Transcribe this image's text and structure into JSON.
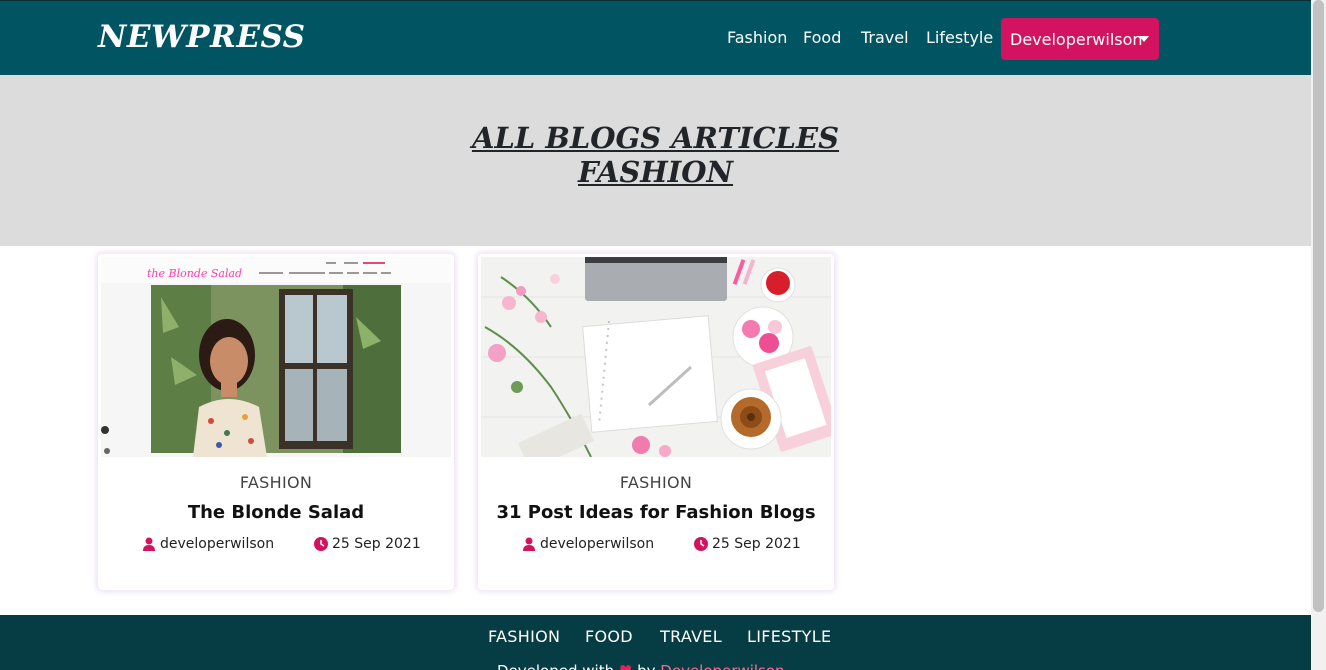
{
  "brand": {
    "name": "NEWPRESS"
  },
  "nav": {
    "links": [
      "Fashion",
      "Food",
      "Travel",
      "Lifestyle"
    ],
    "user_dropdown": "Developerwilson"
  },
  "hero": {
    "title_line1": "ALL BLOGS ARTICLES",
    "title_line2": "FASHION"
  },
  "posts": [
    {
      "category": "FASHION",
      "title": "The Blonde Salad",
      "author": "developerwilson",
      "date": "25 Sep 2021",
      "image_brand": "the Blonde Salad"
    },
    {
      "category": "FASHION",
      "title": "31 Post Ideas for Fashion Blogs",
      "author": "developerwilson",
      "date": "25 Sep 2021"
    }
  ],
  "footer": {
    "links": [
      "FASHION",
      "FOOD",
      "TRAVEL",
      "LIFESTYLE"
    ],
    "credit_prefix": "Developed with",
    "credit_heart": "♥",
    "credit_by": "by",
    "credit_author": "Developerwilson"
  },
  "colors": {
    "navbar": "#015562",
    "accent": "#d3135f",
    "hero_bg": "#dcdcdc",
    "footer": "#063c44"
  },
  "icons": [
    "user-icon",
    "clock-icon",
    "caret-down-icon",
    "heart-icon"
  ]
}
